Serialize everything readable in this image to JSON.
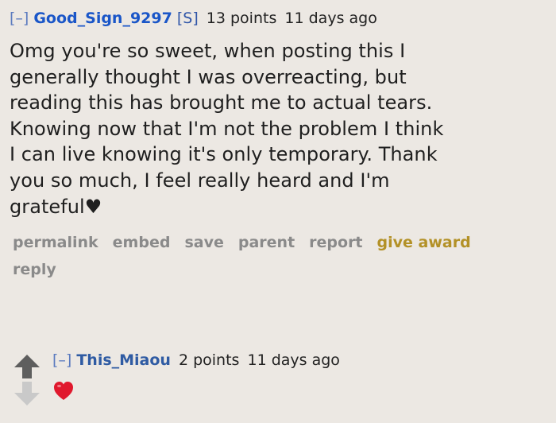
{
  "comment": {
    "collapse": "[–]",
    "author": "Good_Sign_9297",
    "submitter_flag": "[S]",
    "score": "13 points",
    "age": "11 days ago",
    "body_lines": [
      "Omg you're so sweet, when posting this I",
      "generally thought I was overreacting, but",
      "reading this has brought me to actual tears.",
      "Knowing now that I'm not the problem I think",
      "I can live knowing it's only temporary. Thank",
      "you so much, I feel really heard and I'm",
      "grateful♥"
    ],
    "actions": {
      "permalink": "permalink",
      "embed": "embed",
      "save": "save",
      "parent": "parent",
      "report": "report",
      "give_award": "give award",
      "reply": "reply"
    }
  },
  "reply": {
    "collapse": "[–]",
    "author": "This_Miaou",
    "score": "2 points",
    "age": "11 days ago",
    "body_icon": "red-heart-emoji"
  },
  "colors": {
    "background": "#ece8e3",
    "op_author": "#1a56c8",
    "author": "#2f5ba3",
    "action_text": "#8a8a8a",
    "award": "#b39127",
    "heart": "#e0182d"
  }
}
